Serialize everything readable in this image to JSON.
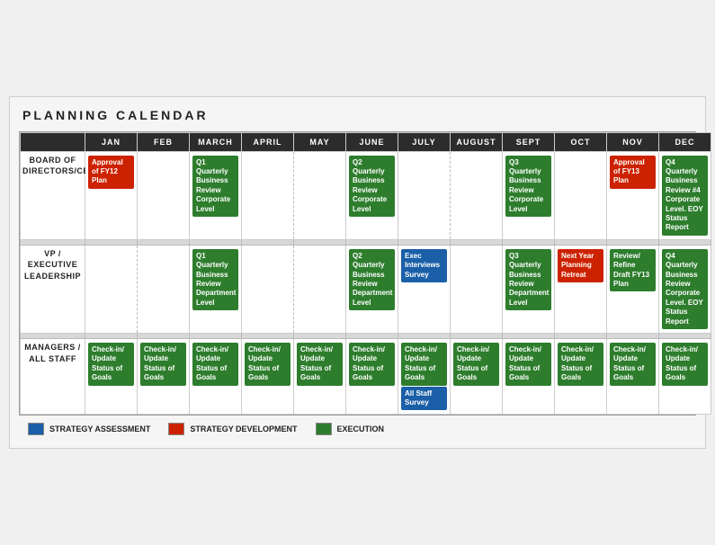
{
  "title": "PLANNING CALENDAR",
  "months": [
    "JAN",
    "FEB",
    "MARCH",
    "APRIL",
    "MAY",
    "JUNE",
    "JULY",
    "AUGUST",
    "SEPT",
    "OCT",
    "NOV",
    "DEC"
  ],
  "rows": [
    {
      "label": "BOARD OF\nDIRECTORS/CEO",
      "cells": {
        "JAN": [
          {
            "text": "Approval of FY12 Plan",
            "type": "red"
          }
        ],
        "FEB": [],
        "MARCH": [
          {
            "text": "Q1 Quarterly Business Review Corporate Level",
            "type": "green"
          }
        ],
        "APRIL": [],
        "MAY": [],
        "JUNE": [
          {
            "text": "Q2 Quarterly Business Review Corporate Level",
            "type": "green"
          }
        ],
        "JULY": [],
        "AUGUST": [],
        "SEPT": [
          {
            "text": "Q3 Quarterly Business Review Corporate Level",
            "type": "green"
          }
        ],
        "OCT": [],
        "NOV": [
          {
            "text": "Approval of FY13 Plan",
            "type": "red"
          }
        ],
        "DEC": [
          {
            "text": "Q4 Quarterly Business Review #4 Corporate Level. EOY Status Report",
            "type": "green"
          }
        ]
      }
    },
    {
      "label": "VP / EXECUTIVE\nLEADERSHIP",
      "cells": {
        "JAN": [],
        "FEB": [],
        "MARCH": [
          {
            "text": "Q1 Quarterly Business Review Department Level",
            "type": "green"
          }
        ],
        "APRIL": [],
        "MAY": [],
        "JUNE": [
          {
            "text": "Q2 Quarterly Business Review Department Level",
            "type": "green"
          }
        ],
        "JULY": [
          {
            "text": "Exec Interviews Survey",
            "type": "blue"
          }
        ],
        "AUGUST": [],
        "SEPT": [
          {
            "text": "Q3 Quarterly Business Review Department Level",
            "type": "green"
          }
        ],
        "OCT": [
          {
            "text": "Next Year Planning Retreat",
            "type": "red"
          }
        ],
        "NOV": [
          {
            "text": "Review/ Refine Draft FY13 Plan",
            "type": "green"
          }
        ],
        "DEC": [
          {
            "text": "Q4 Quarterly Business Review Corporate Level. EOY Status Report",
            "type": "green"
          }
        ]
      }
    },
    {
      "label": "MANAGERS /\nALL STAFF",
      "cells": {
        "JAN": [
          {
            "text": "Check-in/ Update Status of Goals",
            "type": "green"
          }
        ],
        "FEB": [
          {
            "text": "Check-in/ Update Status of Goals",
            "type": "green"
          }
        ],
        "MARCH": [
          {
            "text": "Check-in/ Update Status of Goals",
            "type": "green"
          }
        ],
        "APRIL": [
          {
            "text": "Check-in/ Update Status of Goals",
            "type": "green"
          }
        ],
        "MAY": [
          {
            "text": "Check-in/ Update Status of Goals",
            "type": "green"
          }
        ],
        "JUNE": [
          {
            "text": "Check-in/ Update Status of Goals",
            "type": "green"
          }
        ],
        "JULY": [
          {
            "text": "Check-in/ Update Status of Goals",
            "type": "green"
          },
          {
            "text": "All Staff Survey",
            "type": "blue"
          }
        ],
        "AUGUST": [
          {
            "text": "Check-in/ Update Status of Goals",
            "type": "green"
          }
        ],
        "SEPT": [
          {
            "text": "Check-in/ Update Status of Goals",
            "type": "green"
          }
        ],
        "OCT": [
          {
            "text": "Check-in/ Update Status of Goals",
            "type": "green"
          }
        ],
        "NOV": [
          {
            "text": "Check-in/ Update Status of Goals",
            "type": "green"
          }
        ],
        "DEC": [
          {
            "text": "Check-in/ Update Status of Goals",
            "type": "green"
          }
        ]
      }
    }
  ],
  "legend": [
    {
      "label": "STRATEGY ASSESSMENT",
      "type": "blue"
    },
    {
      "label": "STRATEGY DEVELOPMENT",
      "type": "red"
    },
    {
      "label": "EXECUTION",
      "type": "green"
    }
  ]
}
